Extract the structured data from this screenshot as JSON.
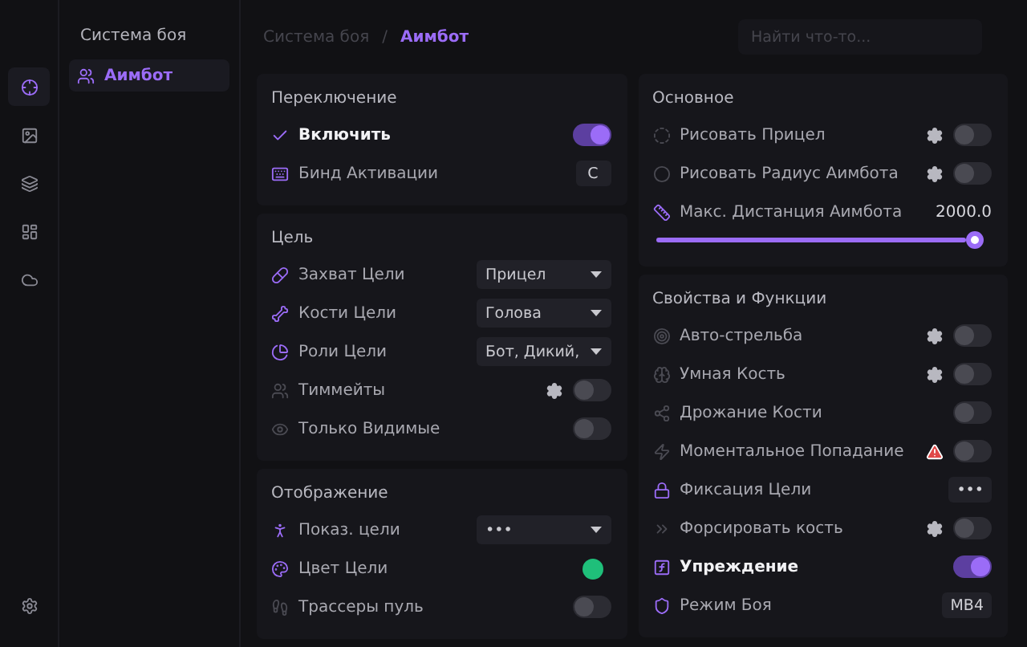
{
  "rail": [
    {
      "selected": true
    },
    {
      "selected": false
    },
    {
      "selected": false
    },
    {
      "selected": false
    },
    {
      "selected": false
    },
    {
      "selected": false
    }
  ],
  "sidebar": {
    "title": "Система боя",
    "items": [
      {
        "label": "Аимбот",
        "selected": true
      }
    ]
  },
  "breadcrumb": {
    "items": [
      "Система боя",
      "Аимбот"
    ],
    "separator": "/"
  },
  "search": {
    "placeholder": "Найти что-то..."
  },
  "columns": [
    {
      "sections": [
        {
          "title": "Переключение",
          "rows": [
            {
              "kind": "toggle",
              "label": "Включить",
              "on": true
            },
            {
              "kind": "key",
              "label": "Бинд Активации",
              "value": "C"
            }
          ]
        },
        {
          "title": "Цель",
          "rows": [
            {
              "kind": "select",
              "label": "Захват Цели",
              "value": "Прицел"
            },
            {
              "kind": "select",
              "label": "Кости Цели",
              "value": "Голова"
            },
            {
              "kind": "select",
              "label": "Роли Цели",
              "value": "Бот, Дикий, "
            },
            {
              "kind": "toggle",
              "label": "Тиммейты",
              "on": false,
              "gear": true
            },
            {
              "kind": "toggle",
              "label": "Только Видимые",
              "on": false
            }
          ]
        },
        {
          "title": "Отображение",
          "rows": [
            {
              "kind": "select",
              "label": "Показ. цели",
              "value": "•••"
            },
            {
              "kind": "color",
              "label": "Цвет Цели",
              "color": "#1fbf7a"
            },
            {
              "kind": "toggle",
              "label": "Трассеры пуль",
              "on": false
            }
          ]
        }
      ]
    },
    {
      "sections": [
        {
          "title": "Основное",
          "rows": [
            {
              "kind": "toggle",
              "label": "Рисовать Прицел",
              "on": false,
              "gear": true
            },
            {
              "kind": "toggle",
              "label": "Рисовать Радиус Аимбота",
              "on": false,
              "gear": true
            },
            {
              "kind": "slider",
              "label": "Макс. Дистанция Аимбота",
              "reading": "2000.0",
              "level": 1
            }
          ]
        },
        {
          "title": "Свойства и Функции",
          "rows": [
            {
              "kind": "toggle",
              "label": "Авто-стрельба",
              "on": false,
              "gear": true
            },
            {
              "kind": "toggle",
              "label": "Умная Кость",
              "on": false,
              "gear": true
            },
            {
              "kind": "toggle",
              "label": "Дрожание Кости",
              "on": false
            },
            {
              "kind": "toggle",
              "label": "Моментальное Попадание",
              "on": false,
              "warning": true
            },
            {
              "kind": "key",
              "label": "Фиксация Цели",
              "value": "•••"
            },
            {
              "kind": "toggle",
              "label": "Форсировать кость",
              "on": false,
              "gear": true
            },
            {
              "kind": "toggle",
              "label": "Упреждение",
              "on": true
            },
            {
              "kind": "key",
              "label": "Режим Боя",
              "value": "MB4"
            }
          ]
        }
      ]
    }
  ]
}
